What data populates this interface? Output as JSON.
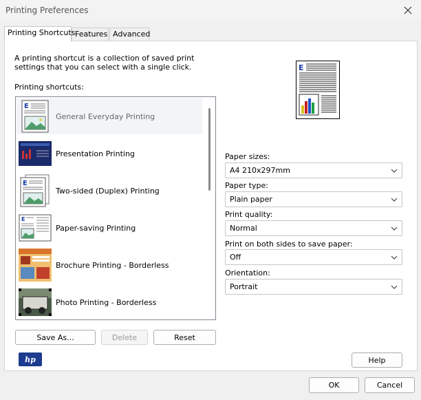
{
  "window": {
    "title": "Printing Preferences"
  },
  "tabs": [
    {
      "label": "Printing Shortcuts",
      "active": true
    },
    {
      "label": "Features",
      "active": false
    },
    {
      "label": "Advanced",
      "active": false
    }
  ],
  "description": "A printing shortcut is a collection of saved print settings that you can select with a single click.",
  "shortcuts": {
    "label": "Printing shortcuts:",
    "items": [
      {
        "label": "General Everyday Printing",
        "icon": "document-page-icon",
        "selected": true
      },
      {
        "label": "Presentation Printing",
        "icon": "presentation-slide-icon"
      },
      {
        "label": "Two-sided (Duplex) Printing",
        "icon": "duplex-pages-icon"
      },
      {
        "label": "Paper-saving Printing",
        "icon": "multi-page-icon"
      },
      {
        "label": "Brochure Printing - Borderless",
        "icon": "brochure-icon"
      },
      {
        "label": "Photo Printing - Borderless",
        "icon": "photo-icon"
      }
    ]
  },
  "buttons": {
    "save_as": "Save As...",
    "delete": "Delete",
    "reset": "Reset",
    "help": "Help",
    "ok": "OK",
    "cancel": "Cancel"
  },
  "settings": {
    "paper_sizes": {
      "label": "Paper sizes:",
      "value": "A4 210x297mm"
    },
    "paper_type": {
      "label": "Paper type:",
      "value": "Plain paper"
    },
    "print_quality": {
      "label": "Print quality:",
      "value": "Normal"
    },
    "duplex": {
      "label": "Print on both sides to save paper:",
      "value": "Off"
    },
    "orientation": {
      "label": "Orientation:",
      "value": "Portrait"
    }
  },
  "brand": {
    "logo_text": "hp",
    "color": "#1d3b8f"
  }
}
